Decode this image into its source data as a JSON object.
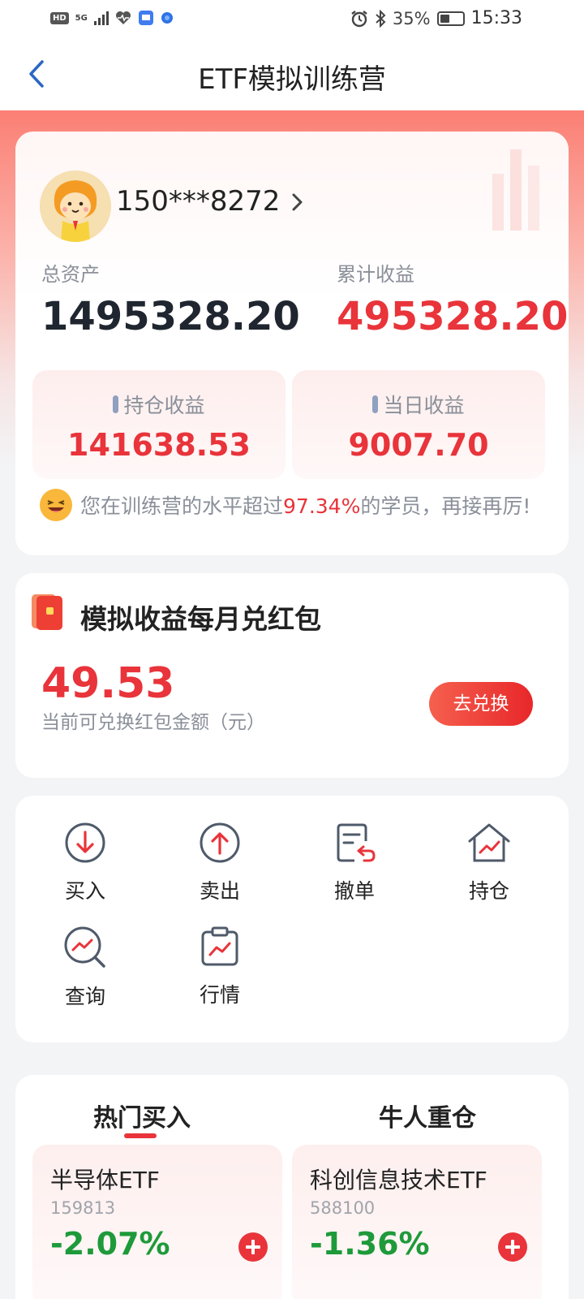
{
  "status_bar": {
    "network": "5G",
    "hd": "HD",
    "battery": "35%",
    "time": "15:33"
  },
  "header": {
    "title": "ETF模拟训练营"
  },
  "account": {
    "username": "150***8272",
    "total_assets_label": "总资产",
    "total_assets": "1495328.20",
    "cumulative_return_label": "累计收益",
    "cumulative_return": "495328.20",
    "position_return_label": "持仓收益",
    "position_return": "141638.53",
    "daily_return_label": "当日收益",
    "daily_return": "9007.70",
    "level_prefix": "您在训练营的水平超过",
    "level_percent": "97.34%",
    "level_suffix": "的学员，再接再厉!"
  },
  "red_packet": {
    "title": "模拟收益每月兑红包",
    "amount": "49.53",
    "desc": "当前可兑换红包金额（元）",
    "button": "去兑换"
  },
  "functions": [
    {
      "label": "买入",
      "icon": "buy-icon"
    },
    {
      "label": "卖出",
      "icon": "sell-icon"
    },
    {
      "label": "撤单",
      "icon": "cancel-order-icon"
    },
    {
      "label": "持仓",
      "icon": "holdings-icon"
    },
    {
      "label": "查询",
      "icon": "query-icon"
    },
    {
      "label": "行情",
      "icon": "market-icon"
    }
  ],
  "hot": {
    "tabs": [
      "热门买入",
      "牛人重仓"
    ],
    "items": [
      {
        "name": "半导体ETF",
        "code": "159813",
        "change": "-2.07%"
      },
      {
        "name": "科创信息技术ETF",
        "code": "588100",
        "change": "-1.36%"
      }
    ]
  },
  "colors": {
    "accent_red": "#e8343a",
    "down_green": "#1e9a3a",
    "muted_gray": "#8a8f99"
  }
}
